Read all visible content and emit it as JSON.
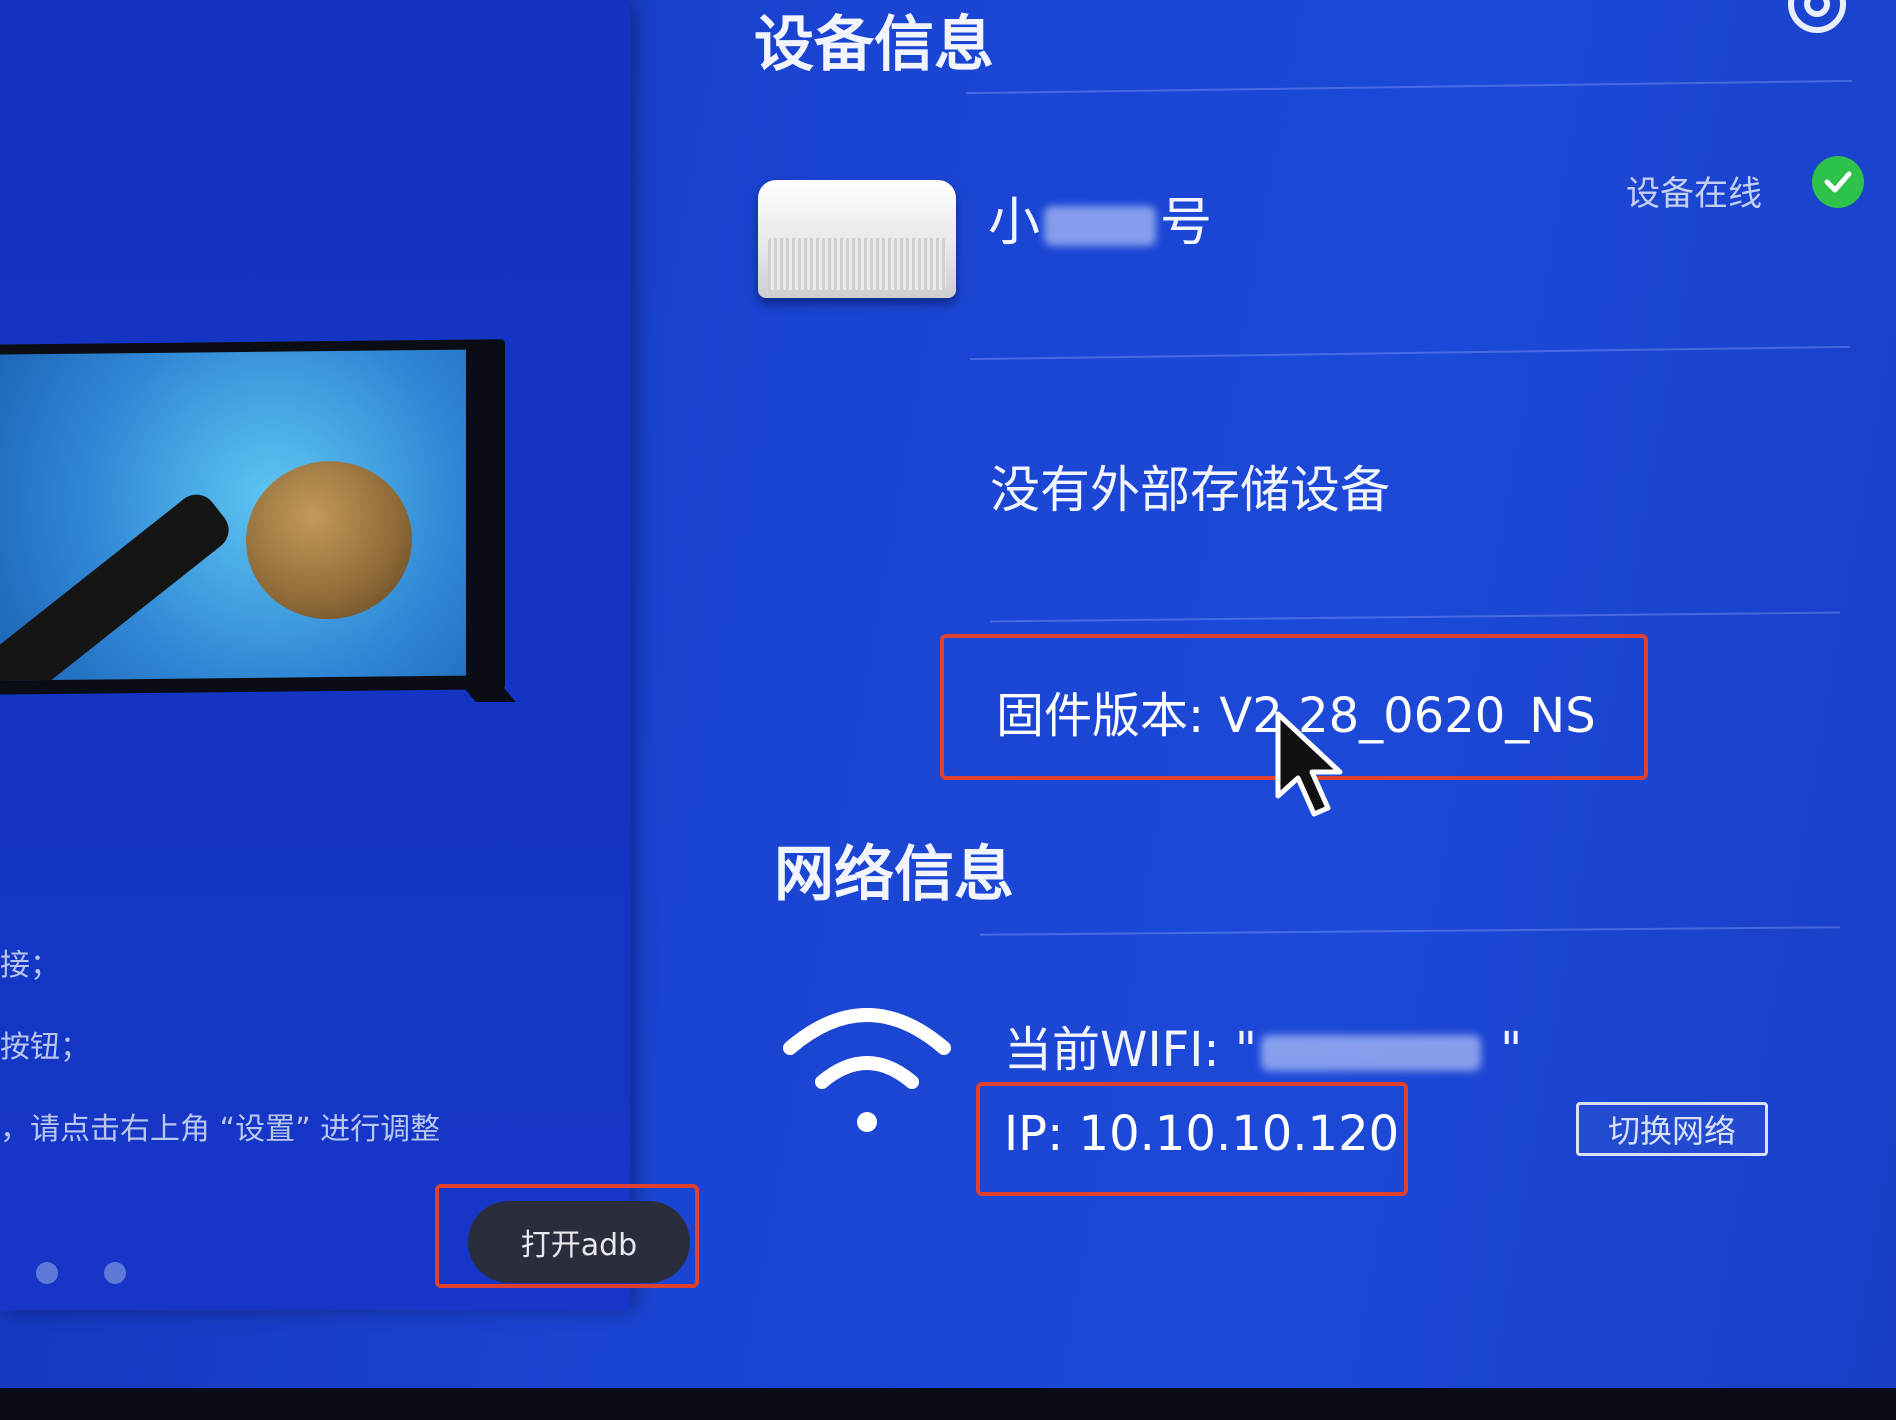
{
  "left_panel": {
    "hints": [
      "接；",
      "按钮；",
      "，请点击右上角 “设置” 进行调整"
    ],
    "toast": "打开adb"
  },
  "device_info": {
    "title": "设备信息",
    "name_prefix": "小",
    "name_suffix": "号",
    "status": "设备在线",
    "storage": "没有外部存储设备",
    "firmware": "固件版本: V2.28_0620_NS"
  },
  "network_info": {
    "title": "网络信息",
    "wifi_label": "当前WIFI: \"",
    "wifi_suffix": " \"",
    "ip": "IP: 10.10.10.120",
    "switch_button": "切换网络"
  },
  "colors": {
    "highlight_box": "#e0402e",
    "online_green": "#2fc24a",
    "background_blue": "#1a44d2"
  },
  "icons": {
    "settings": "gear-icon",
    "online": "check-circle-icon",
    "wifi": "wifi-icon",
    "pointer": "mouse-cursor-icon"
  }
}
